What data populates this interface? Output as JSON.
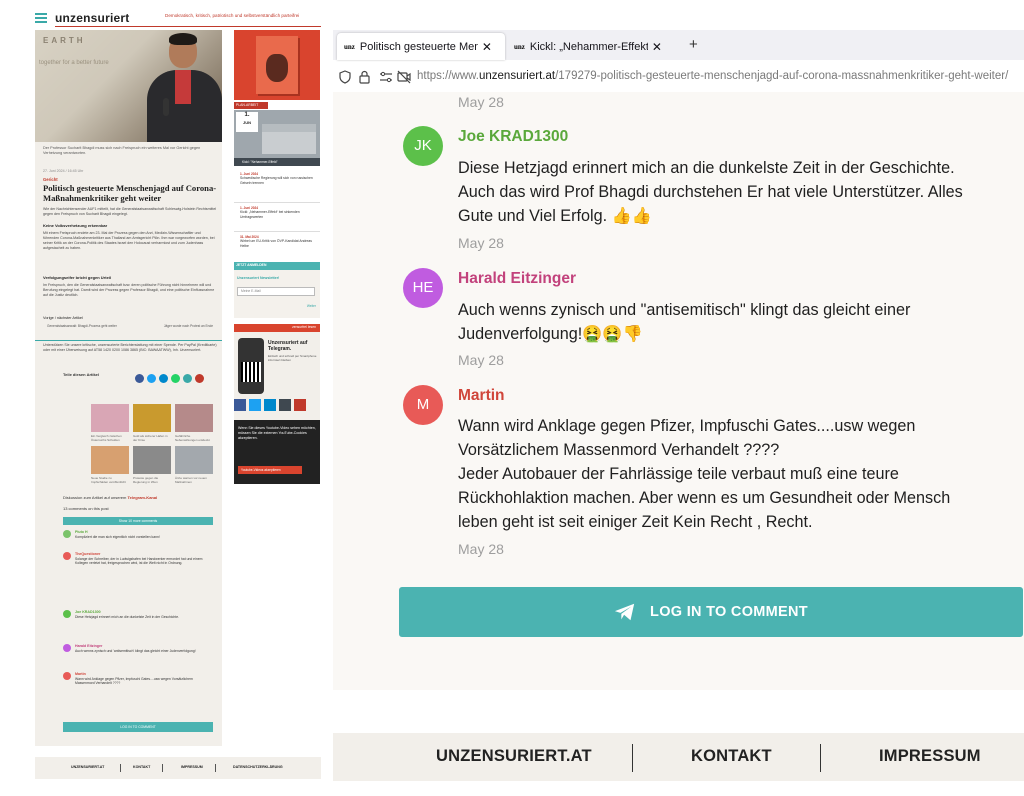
{
  "left_overview": {
    "logo": "unzensuriert",
    "slogan": "Demokratisch, kritisch, patriotisch und selbstverständlich parteifrei",
    "photo_poster_text": "EARTH",
    "photo_poster_sub": "together for a better future",
    "photo_caption": "Der Professor Sucharit Bhagdi muss sich nach Freispruch ein weiteres Mal vor Gericht gegen Verhetzung verantworten.",
    "meta": "27. Juni 2024 / 16:45 Uhr",
    "kicker": "Gericht",
    "title": "Politisch gesteuerte Menschenjagd auf Corona-Maßnahmenkritiker geht weiter",
    "lead": "Wie der Nachrichtensender AUF1 mitteilt, hat die Generalstaatsanwaltschaft Schleswig-Holstein Rechtsmittel gegen den Freispruch von Sucharit Bhagdi eingelegt.",
    "sub1": "Keine Volksverhetzung erkennbar",
    "p1": "Mit einem Freispruch endete am 23. Mai der Prozess gegen den Arzt, Medizin-Wissenschaftler und führenden Corona-Maßnahmenkritiker aus Thailand am Amtsgericht Plön. Ihm war vorgeworfen worden, bei seiner Kritik an der Corona-Politik des Staates Israel den Holocaust verharmlost und zum Judenhass aufgestachelt zu haben.",
    "sub2": "Verfolgungseifer bricht gegen Urteil",
    "p2": "Im Freispruch, den die Generalstaatsanwaltschaft bzw. deren politische Führung nicht hinnehmen will und Berufung eingelegt hat. Damit wird der Prozess gegen Professor Bhagdi, und eine politische Einflussnahme auf die Justiz deutlich.",
    "nav_label": "Vorige / nächster Artikel",
    "nav_prev": "Generalstaatsanwalt: Bhagdi-Prozess geht weiter",
    "nav_next": "Jäger wurde nach Protest an Ende",
    "support": "Unterstützen Sie unsere kritische, unzensurierte Berichterstattung mit einer Spende. Per PayPal (Kreditkarte) oder mit einer Überweisung auf AT58 1420 0200 1086 3865 (BIC: BAWAATWW), Inh. Unzensuriert.",
    "share_label": "Teile diesen Artikel",
    "related": [
      "Ein Vergleich zwischen Österreichs Schulden",
      "Gold als sicherer Hafen in der Krise",
      "Gefährliche Nebenwirkungen entdeckt",
      "Neue Studie zu Impfschäden veröffentlicht",
      "Proteste gegen die Regierung in Wien",
      "Ärzte warnen vor neuen Maßnahmen"
    ],
    "telegram_line_prefix": "Diskussion zum Artikel auf unserem",
    "telegram_line_link": "Telegram-Kanal",
    "comments_count": "13 comments on this post",
    "show_more": "Show 10 more comments",
    "comments": [
      {
        "name": "Pluto H",
        "text": "Kompliziert die man sich eigentlich nicht vorstellen kann!",
        "date": "May 28"
      },
      {
        "name": "TheQuestioner",
        "text": "Solange der Schreiber, der in Ludwigshafen bei Handwerker ermordet hat und einem Kollegen verletzt hat, freigesprochen wird, ist die Welt nicht in Ordnung.",
        "date": "May 28"
      },
      {
        "name": "Joe KRAD1300",
        "text": "Diese Hetzjagd erinnert mich an die dunkelste Zeit in der Geschichte.",
        "date": "May 28"
      },
      {
        "name": "Harald Eitzinger",
        "text": "Auch wenns zynisch und 'antisemitisch' klingt das gleicht einer Judenverfolgung!",
        "date": "May 28"
      },
      {
        "name": "Martin",
        "text": "Wann wird Anklage gegen Pfizer, Impfuschi Gates....usw wegen Vorsätzlichem Massenmord Verhandelt ????",
        "date": "May 28"
      }
    ],
    "login_label": "LOG IN TO COMMENT",
    "sidebar": {
      "book_label": "PLAN-ARBEIT",
      "cal_day": "1.",
      "cal_month": "JUN",
      "cal_caption": "Kickl: \"Nehammer-Effekt\"",
      "news": [
        {
          "date": "1. Juni 2024",
          "text": "Schwedische Regierung will sich von russischen Geiseln trennen"
        },
        {
          "date": "1. Juni 2024",
          "text": "Kickl: „Nehammer-Effekt“ bei sinkenden Umfragewerten"
        },
        {
          "date": "31. Mai 2024",
          "text": "Wirbel um EU-Kritik von ÖVP-Kandidat Andreas Helbe"
        }
      ],
      "newsletter_header": "JETZT ANMELDEN",
      "newsletter_title": "Unzensuriert Newsletter!",
      "newsletter_placeholder": "Meine E-Mail",
      "newsletter_next": "Weiter",
      "telegram_header": "zensurfrei lesen",
      "telegram_title": "Unzensuriert auf Telegram.",
      "telegram_sub": "Einfach und schnell per Smartphone informiert bleiben",
      "yt_text": "Wenn Sie dieses Youtube-Video sehen möchten, müssen Sie die externen YouTube-Cookies akzeptieren.",
      "yt_button": "Youtube-Videos akzeptieren"
    },
    "footer": [
      "UNZENSURIERT.AT",
      "KONTAKT",
      "IMPRESSUM",
      "DATENSCHUTZERKLÄRUNG"
    ]
  },
  "browser": {
    "tabs": [
      {
        "favicon": "unz",
        "title": "Politisch gesteuerte Menschenjag",
        "active": true
      },
      {
        "favicon": "unz",
        "title": "Kickl: „Nehammer-Effekt“ bei s",
        "active": false
      }
    ],
    "new_tab": "+",
    "url_prefix": "https://www.",
    "url_domain": "unzensuriert.at",
    "url_path": "/179279-politisch-gesteuerte-menschenjagd-auf-corona-massnahmenkritiker-geht-weiter/"
  },
  "comments": {
    "top_date": "May 28",
    "items": [
      {
        "initials": "JK",
        "name": "Joe KRAD1300",
        "name_color": "#5aa83b",
        "avatar_color": "#5cc04a",
        "text_lines": [
          "Diese Hetzjagd erinnert mich an die dunkelste Zeit in der Geschichte.",
          "Auch das wird Prof Bhagdi durchstehen Er hat viele Unterstützer. Alles",
          "Gute und Viel Erfolg. 👍👍"
        ],
        "date": "May 28"
      },
      {
        "initials": "HE",
        "name": "Harald Eitzinger",
        "name_color": "#c2427c",
        "avatar_color": "#c05ce0",
        "text_lines": [
          "Auch wenns zynisch und \"antisemitisch\" klingt das gleicht einer",
          "Judenverfolgung!🤮🤮👎"
        ],
        "date": "May 28"
      },
      {
        "initials": "M",
        "name": "Martin",
        "name_color": "#d0453a",
        "avatar_color": "#e85a57",
        "text_lines": [
          "Wann wird Anklage gegen Pfizer, Impfuschi Gates....usw wegen",
          "Vorsätzlichem Massenmord Verhandelt ????",
          "Jeder Autobauer der Fahrlässige teile verbaut muß eine teure",
          "Rückhohlaktion machen. Aber wenn es um Gesundheit oder Mensch",
          "leben geht ist seit einiger Zeit Kein Recht , Recht."
        ],
        "date": "May 28"
      }
    ],
    "login_button": "LOG IN TO COMMENT"
  },
  "footer": {
    "links": [
      "UNZENSURIERT.AT",
      "KONTAKT",
      "IMPRESSUM"
    ]
  },
  "colors": {
    "teal": "#4bb3b1",
    "brand_red": "#c0392b",
    "footer_bg": "#f2efea"
  }
}
